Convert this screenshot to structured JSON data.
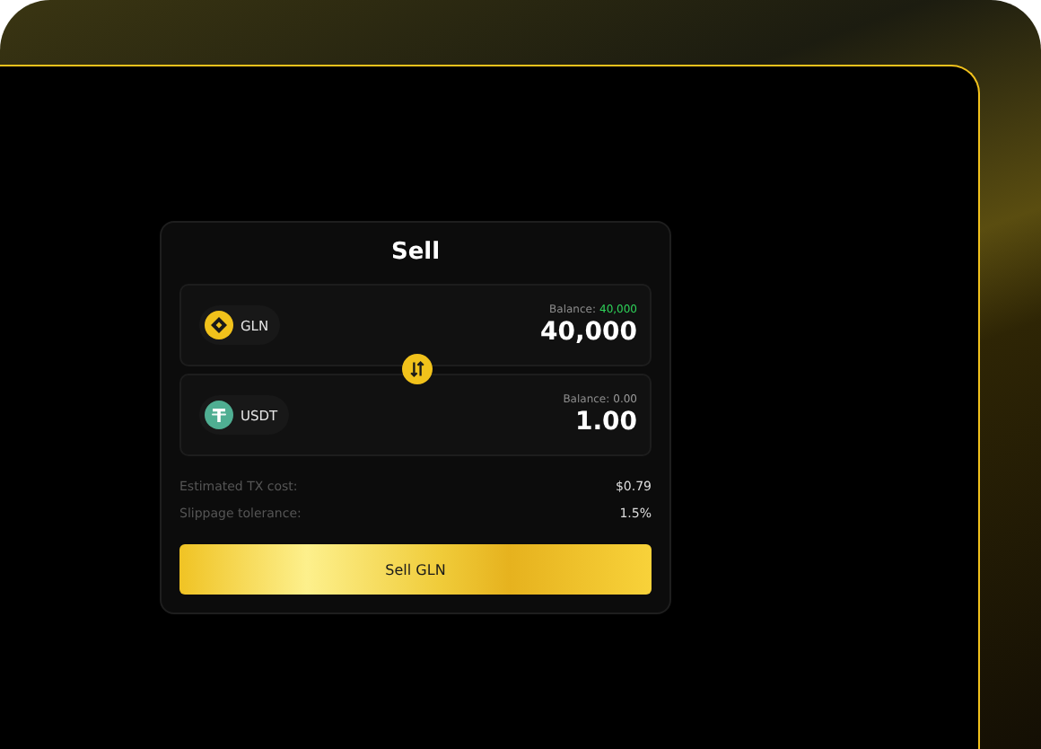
{
  "card": {
    "title": "Sell"
  },
  "tokens": [
    {
      "symbol": "GLN",
      "kind": "gln",
      "balance_label": "Balance:",
      "balance": "40,000",
      "color": "#2fd45a",
      "amount": "40,000"
    },
    {
      "symbol": "USDT",
      "kind": "usdt",
      "balance_label": "Balance:",
      "balance": "0.00",
      "color": "#9a9a9a",
      "amount": "1.00"
    }
  ],
  "details": [
    {
      "label": "Estimated TX cost:",
      "value": "$0.79"
    },
    {
      "label": "Slippage tolerance:",
      "value": "1.5%"
    }
  ],
  "action_button": "Sell GLN"
}
